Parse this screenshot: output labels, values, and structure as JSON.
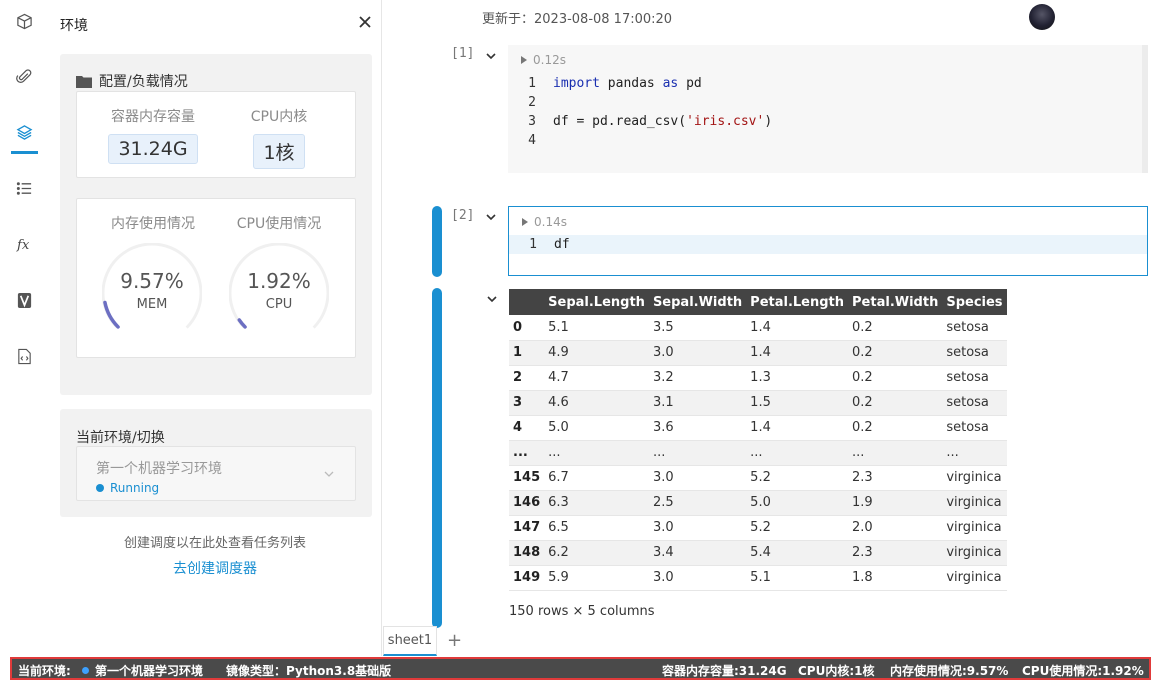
{
  "rail": {
    "items": [
      "package-icon",
      "attachment-icon",
      "layers-icon",
      "list-icon",
      "function-icon",
      "variable-icon",
      "file-code-icon"
    ],
    "active": "layers-icon"
  },
  "panel": {
    "title": "环境",
    "config": {
      "title": "配置/负载情况",
      "capacity": {
        "memory_label": "容器内存容量",
        "memory_value": "31.24G",
        "cpu_label": "CPU内核",
        "cpu_value": "1核"
      },
      "usage": {
        "memory_label": "内存使用情况",
        "memory_value": "9.57%",
        "memory_sub": "MEM",
        "memory_fraction": 0.0957,
        "cpu_label": "CPU使用情况",
        "cpu_value": "1.92%",
        "cpu_sub": "CPU",
        "cpu_fraction": 0.0192
      }
    },
    "environment": {
      "title": "当前环境/切换",
      "name": "第一个机器学习环境",
      "status": "Running"
    },
    "schedule": {
      "hint": "创建调度以在此处查看任务列表",
      "link": "去创建调度器"
    }
  },
  "notebook": {
    "updated": "更新于：2023-08-08 17:00:20",
    "cells": [
      {
        "label": "[1]",
        "time": "0.12s",
        "lines": [
          {
            "n": "1",
            "code": "import pandas as pd"
          },
          {
            "n": "2",
            "code": ""
          },
          {
            "n": "3",
            "code": "df = pd.read_csv('iris.csv')"
          },
          {
            "n": "4",
            "code": ""
          }
        ]
      },
      {
        "label": "[2]",
        "time": "0.14s",
        "lines": [
          {
            "n": "1",
            "code": "df"
          }
        ]
      }
    ],
    "output": {
      "columns": [
        "",
        "Sepal.Length",
        "Sepal.Width",
        "Petal.Length",
        "Petal.Width",
        "Species"
      ],
      "rows": [
        [
          "0",
          "5.1",
          "3.5",
          "1.4",
          "0.2",
          "setosa"
        ],
        [
          "1",
          "4.9",
          "3.0",
          "1.4",
          "0.2",
          "setosa"
        ],
        [
          "2",
          "4.7",
          "3.2",
          "1.3",
          "0.2",
          "setosa"
        ],
        [
          "3",
          "4.6",
          "3.1",
          "1.5",
          "0.2",
          "setosa"
        ],
        [
          "4",
          "5.0",
          "3.6",
          "1.4",
          "0.2",
          "setosa"
        ],
        [
          "...",
          "...",
          "...",
          "...",
          "...",
          "..."
        ],
        [
          "145",
          "6.7",
          "3.0",
          "5.2",
          "2.3",
          "virginica"
        ],
        [
          "146",
          "6.3",
          "2.5",
          "5.0",
          "1.9",
          "virginica"
        ],
        [
          "147",
          "6.5",
          "3.0",
          "5.2",
          "2.0",
          "virginica"
        ],
        [
          "148",
          "6.2",
          "3.4",
          "5.4",
          "2.3",
          "virginica"
        ],
        [
          "149",
          "5.9",
          "3.0",
          "5.1",
          "1.8",
          "virginica"
        ]
      ],
      "shape": "150 rows × 5 columns"
    },
    "sheet_tab": "sheet1",
    "add_sheet": "+"
  },
  "statusbar": {
    "env_label": "当前环境:",
    "env_name": "第一个机器学习环境",
    "image_type": "镜像类型：Python3.8基础版",
    "memory": "容器内存容量:31.24G",
    "cpu": "CPU内核:1核",
    "memory_usage": "内存使用情况:9.57%",
    "cpu_usage": "CPU使用情况:1.92%"
  },
  "colors": {
    "accent": "#1a8fd1",
    "gauge": "#6c6fc2",
    "status_border": "#e03a3a"
  }
}
